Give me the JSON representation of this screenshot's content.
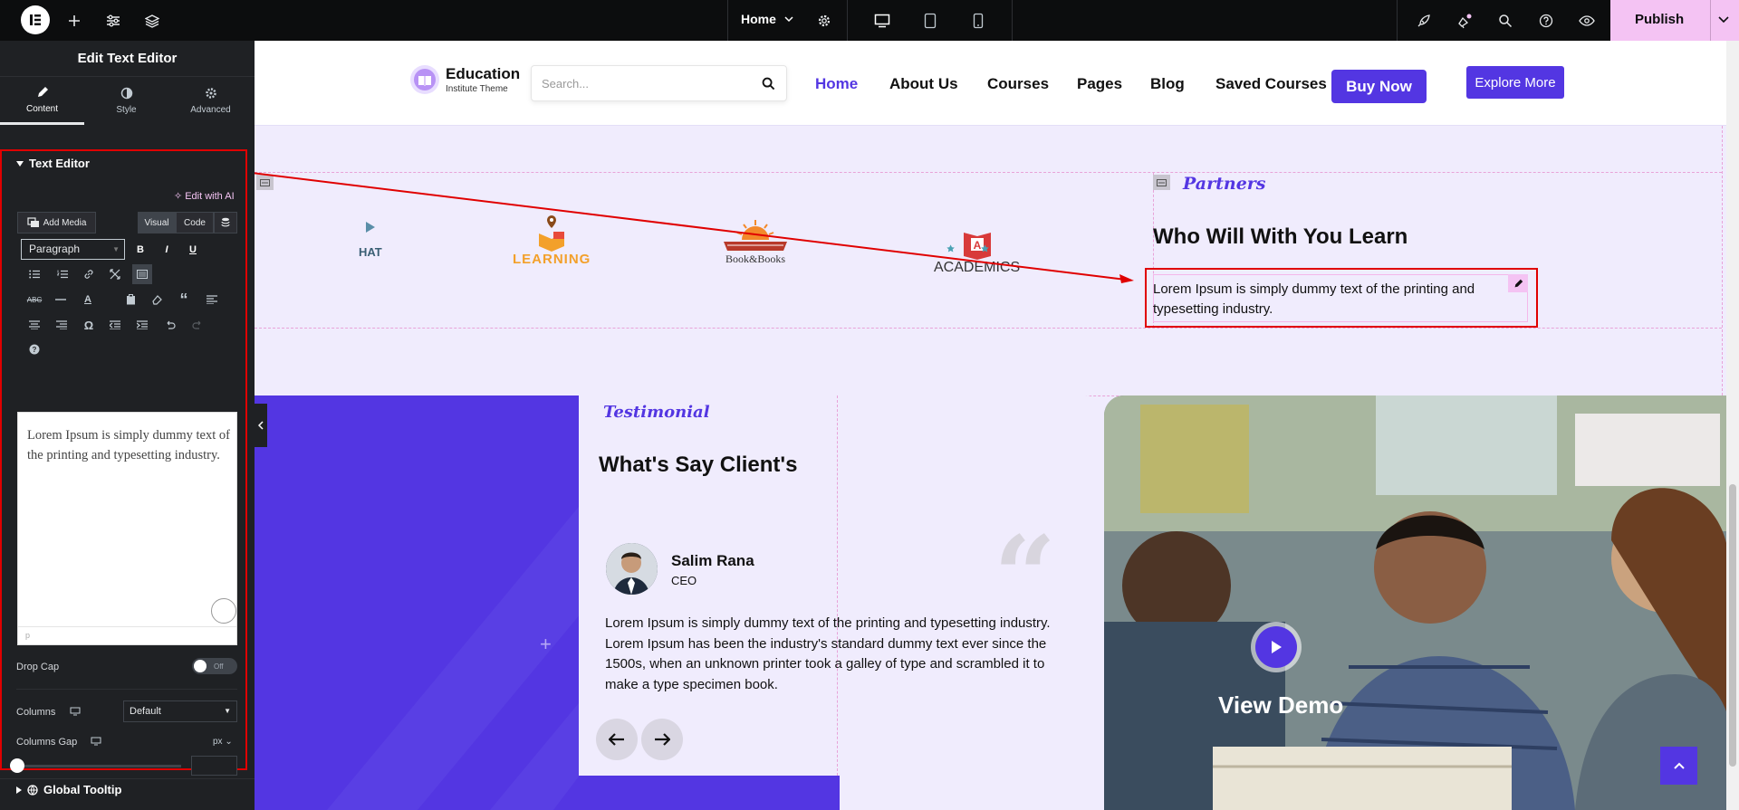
{
  "topbar": {
    "page_selector": "Home",
    "publish_label": "Publish"
  },
  "panel": {
    "title": "Edit Text Editor",
    "tabs": [
      {
        "label": "Content"
      },
      {
        "label": "Style"
      },
      {
        "label": "Advanced"
      }
    ],
    "section_title": "Text Editor",
    "edit_with_ai": "Edit with AI",
    "add_media": "Add Media",
    "visual_tab": "Visual",
    "code_tab": "Code",
    "format_select": "Paragraph",
    "editor_content": "Lorem Ipsum is simply dummy text of the printing and typesetting industry.",
    "editor_path": "p",
    "drop_cap_label": "Drop Cap",
    "drop_cap_state": "Off",
    "columns_label": "Columns",
    "columns_value": "Default",
    "columns_gap_label": "Columns Gap",
    "columns_gap_unit": "px",
    "global_tooltip": "Global Tooltip"
  },
  "site": {
    "logo_title": "Education",
    "logo_subtitle": "Institute Theme",
    "search_placeholder": "Search...",
    "nav": [
      "Home",
      "About Us",
      "Courses",
      "Pages",
      "Blog",
      "Saved Courses"
    ],
    "buy_now": "Buy Now",
    "explore_more": "Explore More",
    "partners_tag": "Partners",
    "partners_heading": "Who Will With You Learn",
    "partners_text": "Lorem Ipsum is simply dummy text of the printing and typesetting industry.",
    "partner_logos": [
      {
        "name": "HAT"
      },
      {
        "name": "LEARNING"
      },
      {
        "name": "Book&Books"
      },
      {
        "name": "ACADEMICS"
      }
    ],
    "testimonial_tag": "Testimonial",
    "testimonial_heading": "What's Say Client's",
    "client_name": "Salim Rana",
    "client_role": "CEO",
    "testimonial_text": "Lorem Ipsum is simply dummy text of the printing and typesetting industry. Lorem Ipsum has been the industry's standard dummy text ever since the 1500s, when an unknown printer took a galley of type and scrambled it to make a type specimen book.",
    "view_demo": "View Demo"
  },
  "colors": {
    "accent": "#5336e2",
    "publish_bg": "#f4c3f3",
    "canvas_bg": "#f0ecfd",
    "highlight": "#e00000"
  }
}
